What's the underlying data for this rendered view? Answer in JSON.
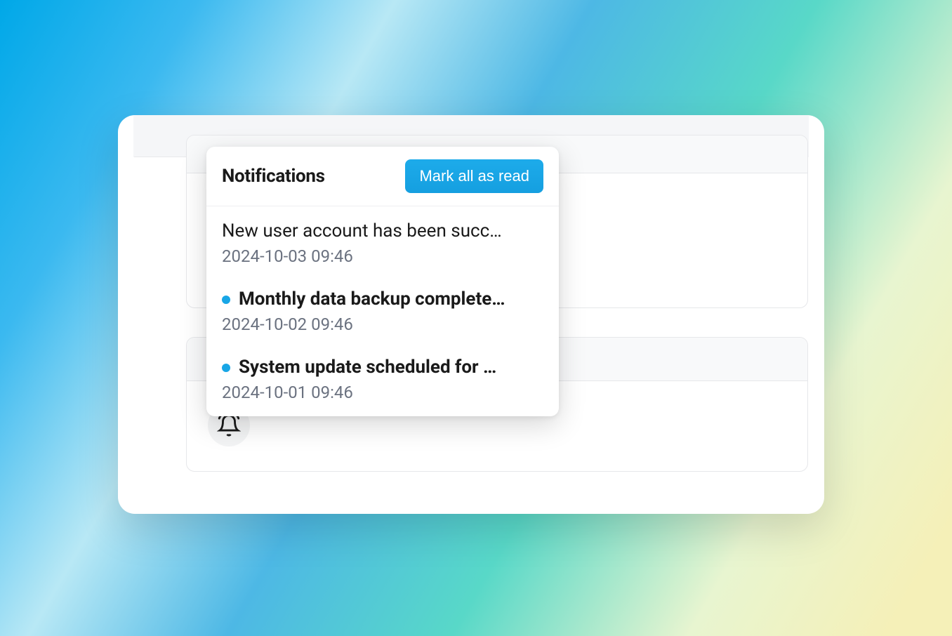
{
  "popover": {
    "title": "Notifications",
    "mark_read_label": "Mark all as read"
  },
  "notifications": [
    {
      "title": "New user account has been succ…",
      "time": "2024-10-03 09:46",
      "unread": false
    },
    {
      "title": "Monthly data backup complete…",
      "time": "2024-10-02 09:46",
      "unread": true
    },
    {
      "title": "System update scheduled for …",
      "time": "2024-10-01 09:46",
      "unread": true
    }
  ]
}
